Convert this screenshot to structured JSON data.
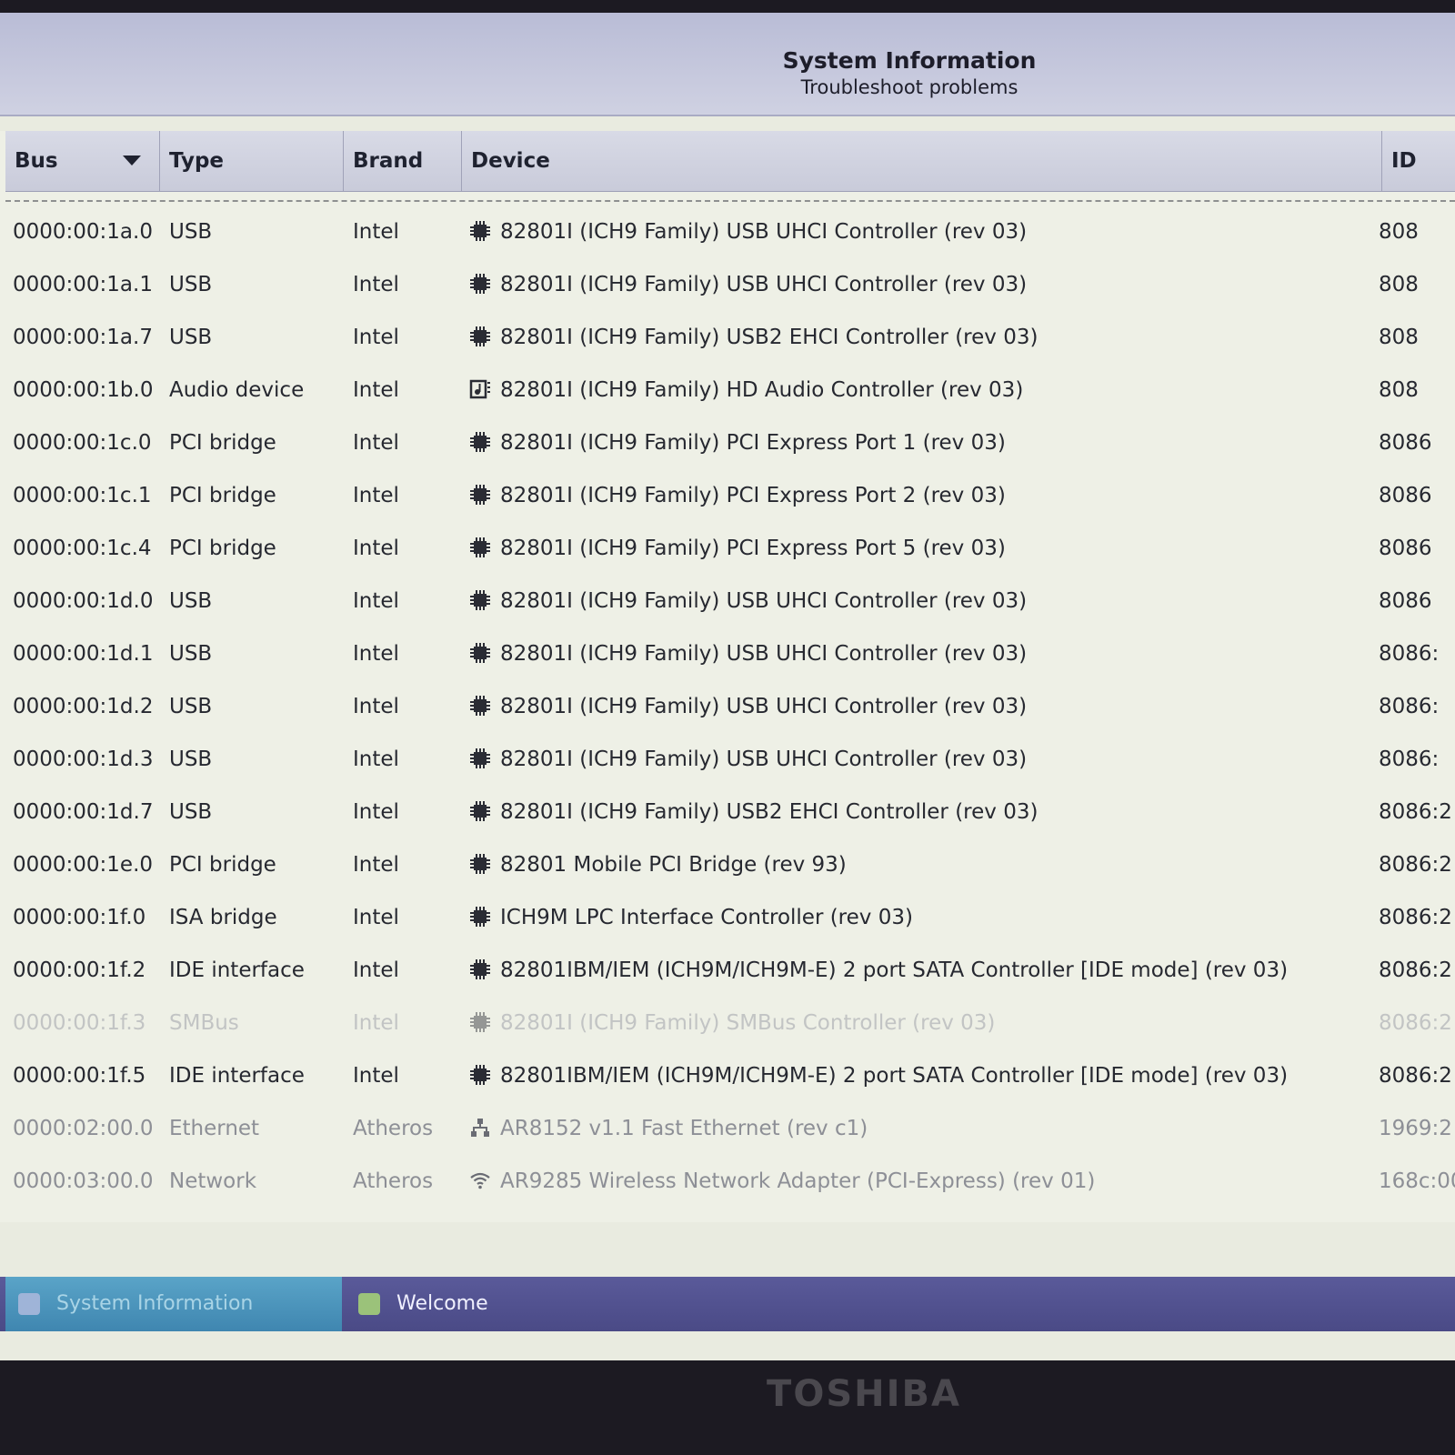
{
  "window": {
    "title": "System Information",
    "subtitle": "Troubleshoot problems"
  },
  "table": {
    "columns": {
      "bus": "Bus",
      "type": "Type",
      "brand": "Brand",
      "device": "Device",
      "id": "ID"
    },
    "rows": [
      {
        "bus": "0000:00:1a.0",
        "type": "USB",
        "brand": "Intel",
        "device": "82801I (ICH9 Family) USB UHCI Controller (rev 03)",
        "id": "808",
        "icon": "chip-icon",
        "style": "normal"
      },
      {
        "bus": "0000:00:1a.1",
        "type": "USB",
        "brand": "Intel",
        "device": "82801I (ICH9 Family) USB UHCI Controller (rev 03)",
        "id": "808",
        "icon": "chip-icon",
        "style": "normal"
      },
      {
        "bus": "0000:00:1a.7",
        "type": "USB",
        "brand": "Intel",
        "device": "82801I (ICH9 Family) USB2 EHCI Controller (rev 03)",
        "id": "808",
        "icon": "chip-icon",
        "style": "normal"
      },
      {
        "bus": "0000:00:1b.0",
        "type": "Audio device",
        "brand": "Intel",
        "device": "82801I (ICH9 Family) HD Audio Controller (rev 03)",
        "id": "808",
        "icon": "audio-icon",
        "style": "normal"
      },
      {
        "bus": "0000:00:1c.0",
        "type": "PCI bridge",
        "brand": "Intel",
        "device": "82801I (ICH9 Family) PCI Express Port 1 (rev 03)",
        "id": "8086",
        "icon": "chip-icon",
        "style": "normal"
      },
      {
        "bus": "0000:00:1c.1",
        "type": "PCI bridge",
        "brand": "Intel",
        "device": "82801I (ICH9 Family) PCI Express Port 2 (rev 03)",
        "id": "8086",
        "icon": "chip-icon",
        "style": "normal"
      },
      {
        "bus": "0000:00:1c.4",
        "type": "PCI bridge",
        "brand": "Intel",
        "device": "82801I (ICH9 Family) PCI Express Port 5 (rev 03)",
        "id": "8086",
        "icon": "chip-icon",
        "style": "normal"
      },
      {
        "bus": "0000:00:1d.0",
        "type": "USB",
        "brand": "Intel",
        "device": "82801I (ICH9 Family) USB UHCI Controller (rev 03)",
        "id": "8086",
        "icon": "chip-icon",
        "style": "normal"
      },
      {
        "bus": "0000:00:1d.1",
        "type": "USB",
        "brand": "Intel",
        "device": "82801I (ICH9 Family) USB UHCI Controller (rev 03)",
        "id": "8086:",
        "icon": "chip-icon",
        "style": "normal"
      },
      {
        "bus": "0000:00:1d.2",
        "type": "USB",
        "brand": "Intel",
        "device": "82801I (ICH9 Family) USB UHCI Controller (rev 03)",
        "id": "8086:",
        "icon": "chip-icon",
        "style": "normal"
      },
      {
        "bus": "0000:00:1d.3",
        "type": "USB",
        "brand": "Intel",
        "device": "82801I (ICH9 Family) USB UHCI Controller (rev 03)",
        "id": "8086:",
        "icon": "chip-icon",
        "style": "normal"
      },
      {
        "bus": "0000:00:1d.7",
        "type": "USB",
        "brand": "Intel",
        "device": "82801I (ICH9 Family) USB2 EHCI Controller (rev 03)",
        "id": "8086:2",
        "icon": "chip-icon",
        "style": "normal"
      },
      {
        "bus": "0000:00:1e.0",
        "type": "PCI bridge",
        "brand": "Intel",
        "device": "82801 Mobile PCI Bridge (rev 93)",
        "id": "8086:2",
        "icon": "chip-icon",
        "style": "normal"
      },
      {
        "bus": "0000:00:1f.0",
        "type": "ISA bridge",
        "brand": "Intel",
        "device": "ICH9M LPC Interface Controller (rev 03)",
        "id": "8086:2",
        "icon": "chip-icon",
        "style": "normal"
      },
      {
        "bus": "0000:00:1f.2",
        "type": "IDE interface",
        "brand": "Intel",
        "device": "82801IBM/IEM (ICH9M/ICH9M-E) 2 port SATA Controller [IDE mode] (rev 03)",
        "id": "8086:2",
        "icon": "chip-icon",
        "style": "normal"
      },
      {
        "bus": "0000:00:1f.3",
        "type": "SMBus",
        "brand": "Intel",
        "device": "82801I (ICH9 Family) SMBus Controller (rev 03)",
        "id": "8086:2",
        "icon": "chip-icon",
        "style": "faded"
      },
      {
        "bus": "0000:00:1f.5",
        "type": "IDE interface",
        "brand": "Intel",
        "device": "82801IBM/IEM (ICH9M/ICH9M-E) 2 port SATA Controller [IDE mode] (rev 03)",
        "id": "8086:2",
        "icon": "chip-icon",
        "style": "normal"
      },
      {
        "bus": "0000:02:00.0",
        "type": "Ethernet",
        "brand": "Atheros",
        "device": "AR8152 v1.1 Fast Ethernet (rev c1)",
        "id": "1969:2",
        "icon": "network-icon",
        "style": "dim"
      },
      {
        "bus": "0000:03:00.0",
        "type": "Network",
        "brand": "Atheros",
        "device": "AR9285 Wireless Network Adapter (PCI-Express) (rev 01)",
        "id": "168c:00",
        "icon": "wifi-icon",
        "style": "dim"
      }
    ]
  },
  "taskbar": {
    "active": "System Information",
    "other": "Welcome"
  },
  "bezel": {
    "brand": "TOSHIBA"
  },
  "colors": {
    "accent": "#3f86b0",
    "taskbar": "#4a4a86"
  }
}
